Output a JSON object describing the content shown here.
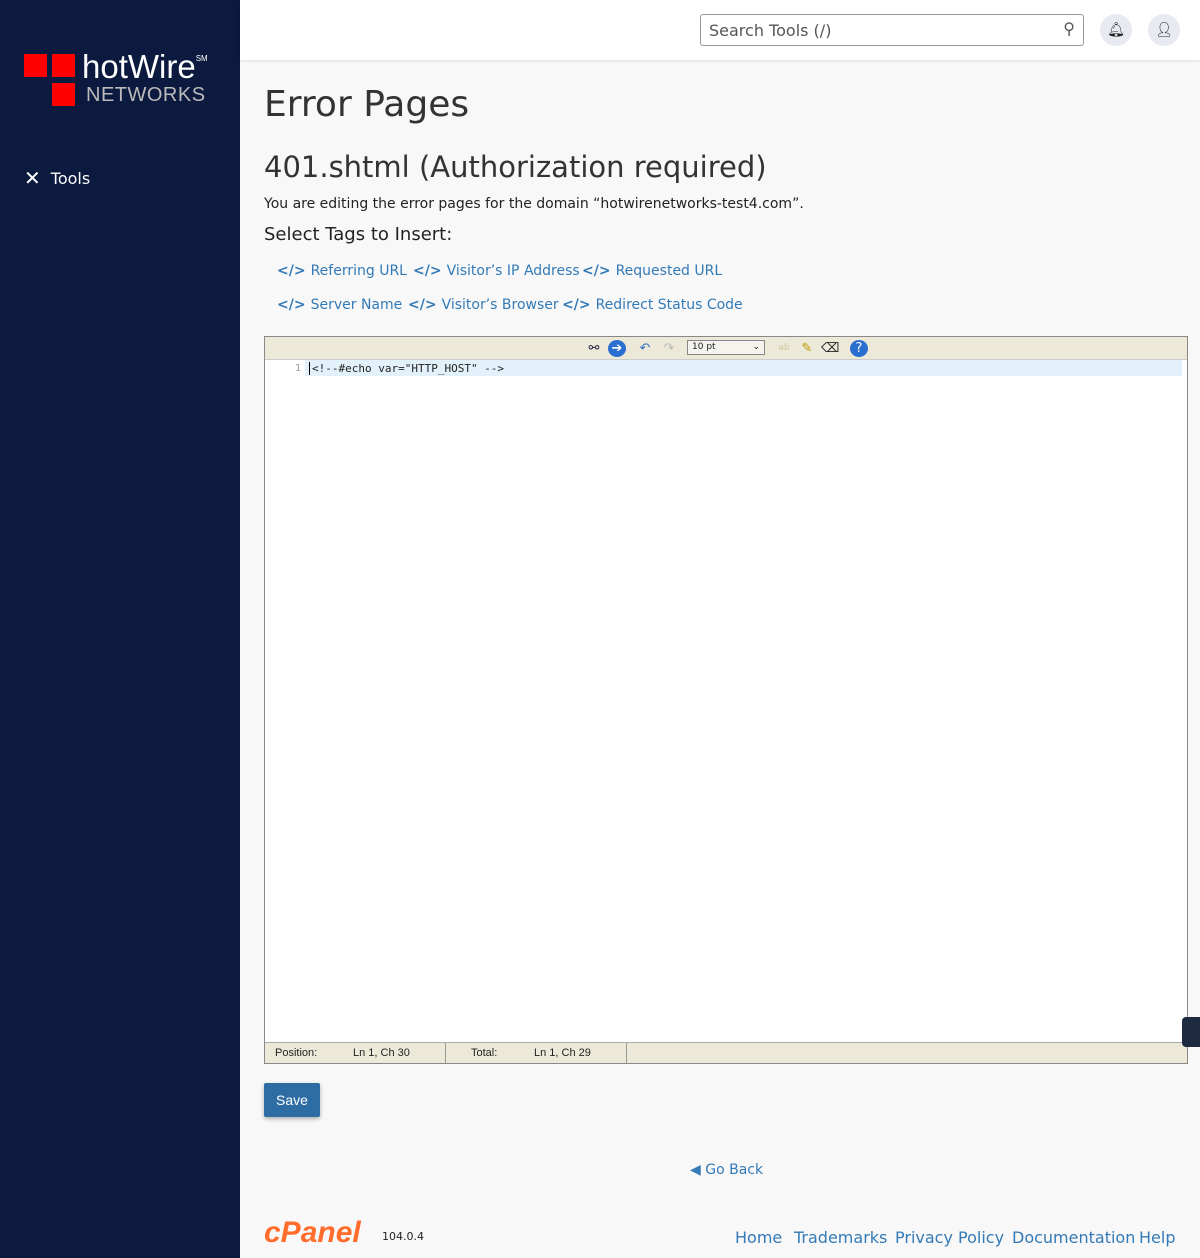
{
  "brand": {
    "name": "hotWire",
    "sm": "SM",
    "sub": "NETWORKS"
  },
  "sidebar": {
    "items": [
      {
        "label": "Tools",
        "icon": "tools-icon"
      }
    ]
  },
  "header": {
    "search_placeholder": "Search Tools (/)"
  },
  "page": {
    "title": "Error Pages",
    "subtitle": "401.shtml (Authorization required)",
    "description": "You are editing the error pages for the domain “hotwirenetworks-test4.com”.",
    "select_tags_label": "Select Tags to Insert:"
  },
  "tags": [
    "Referring URL",
    "Visitor’s IP Address",
    "Requested URL",
    "Server Name",
    "Visitor’s Browser",
    "Redirect Status Code"
  ],
  "editor": {
    "font_size": "10 pt",
    "line_number": "1",
    "code": "<!--#echo var=\"HTTP_HOST\" -->",
    "position_label": "Position:",
    "position_value": "Ln 1, Ch 30",
    "total_label": "Total:",
    "total_value": "Ln 1, Ch 29"
  },
  "save_label": "Save",
  "go_back": "Go Back",
  "footer": {
    "logo": "cPanel",
    "version": "104.0.4",
    "links": [
      "Home",
      "Trademarks",
      "Privacy Policy",
      "Documentation",
      "Help"
    ]
  }
}
